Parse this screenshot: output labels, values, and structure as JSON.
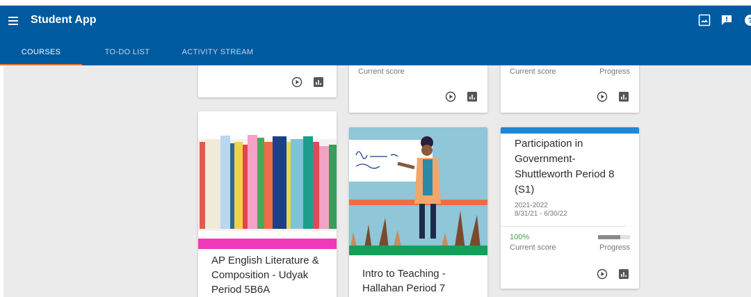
{
  "app": {
    "title": "Student App"
  },
  "tabs": [
    {
      "label": "COURSES",
      "active": true
    },
    {
      "label": "TO-DO LIST",
      "active": false
    },
    {
      "label": "ACTIVITY STREAM",
      "active": false
    }
  ],
  "icons": {
    "menu": "hamburger-menu-icon",
    "gallery": "image-gallery-icon",
    "feedback": "feedback-icon",
    "help": "help-icon",
    "play": "play-circle-icon",
    "chart": "bar-chart-icon"
  },
  "colors": {
    "appbar": "#005a9f",
    "tab_indicator": "#e8743b",
    "card_accent_pink": "#ee3ab8",
    "card_accent_blue": "#1e88d7",
    "card_accent_green": "#14a05a",
    "score_green": "#3aa54a"
  },
  "cards_top": [
    {
      "current_score_label": "",
      "progress_label": ""
    },
    {
      "current_score_label": "Current score",
      "progress_label": ""
    },
    {
      "current_score_label": "Current score",
      "progress_label": "Progress"
    }
  ],
  "cards_bottom": [
    {
      "title": "AP English Literature & Composition - Udyak Period 5B6A"
    },
    {
      "title": "Intro to Teaching - Hallahan Period 7"
    },
    {
      "title": "Participation in Government-Shuttleworth Period 8 (S1)",
      "year": "2021-2022",
      "dates": "8/31/21 - 6/30/22",
      "score": "100%",
      "current_score_label": "Current score",
      "progress_label": "Progress",
      "progress": 0.7
    }
  ]
}
